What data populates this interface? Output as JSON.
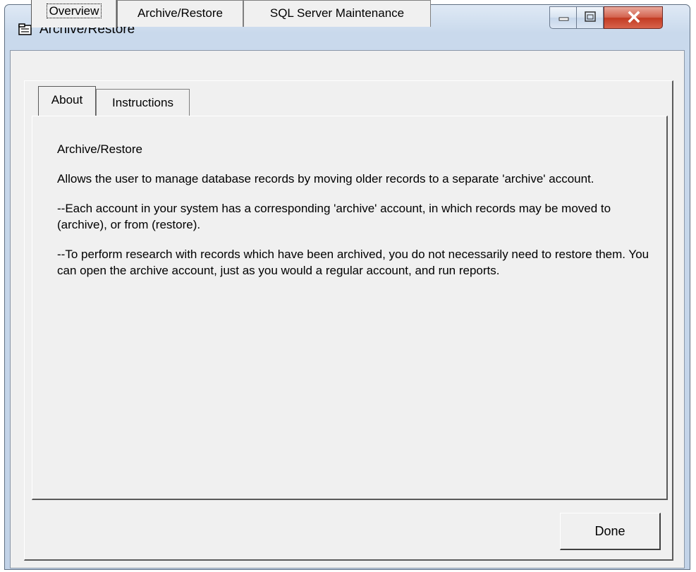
{
  "window": {
    "title": "Archive/Restore",
    "controls": {
      "minimize": "minimize",
      "maximize": "maximize",
      "close": "close"
    }
  },
  "tabs": [
    {
      "label": "Overview",
      "active": true
    },
    {
      "label": "Archive/Restore",
      "active": false
    },
    {
      "label": "SQL Server Maintenance",
      "active": false
    }
  ],
  "subtabs": [
    {
      "label": "About",
      "active": true
    },
    {
      "label": "Instructions",
      "active": false
    }
  ],
  "about": {
    "heading": "Archive/Restore",
    "paragraphs": [
      "Allows the user to manage database records by moving older records to a separate 'archive' account.",
      "--Each account in your system has a corresponding 'archive' account, in which records may be moved to (archive), or from (restore).",
      "--To perform research with records which have been archived, you do not necessarily need to restore them.  You can open the archive account, just as you would a regular account, and run reports."
    ]
  },
  "buttons": {
    "done": "Done"
  }
}
